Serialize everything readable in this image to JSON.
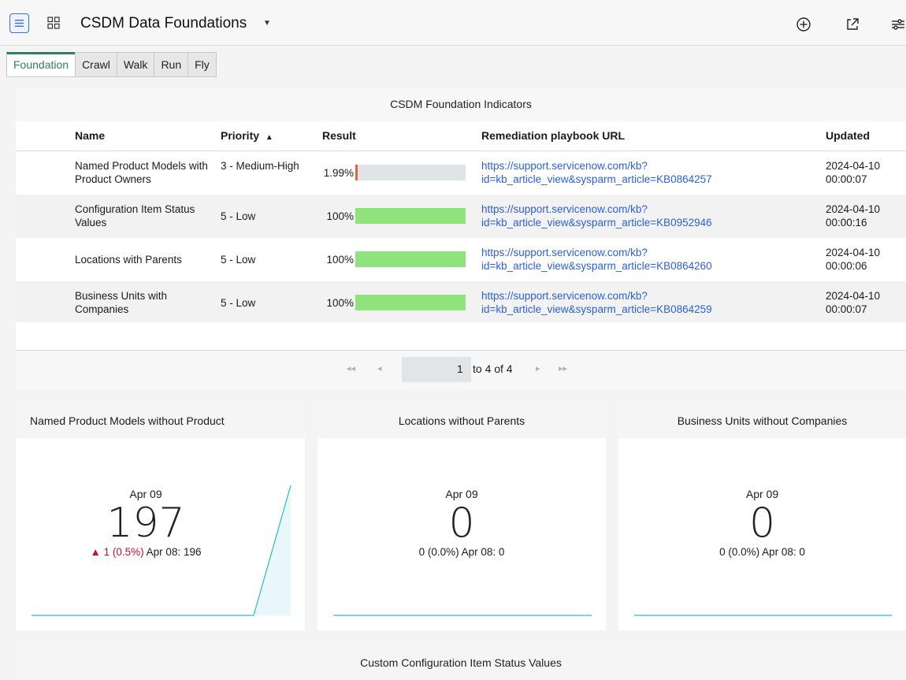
{
  "app": {
    "title": "CSDM Data Foundations"
  },
  "header_icons": [
    "menu-icon",
    "grid-icon",
    "add-icon",
    "share-icon",
    "filter-settings-icon"
  ],
  "tabs": [
    {
      "label": "Foundation",
      "active": true
    },
    {
      "label": "Crawl",
      "active": false
    },
    {
      "label": "Walk",
      "active": false
    },
    {
      "label": "Run",
      "active": false
    },
    {
      "label": "Fly",
      "active": false
    }
  ],
  "indicators": {
    "title": "CSDM Foundation Indicators",
    "columns": {
      "name": "Name",
      "priority": "Priority",
      "priority_sort": "▲",
      "result": "Result",
      "url": "Remediation playbook URL",
      "updated": "Updated"
    },
    "rows": [
      {
        "name": "Named Product Models with Product Owners",
        "priority": "3 - Medium-High",
        "result": "1.99%",
        "result_value": 1.99,
        "result_color": "#e8624a",
        "url": "https://support.servicenow.com/kb?id=kb_article_view&sysparm_article=KB0864257",
        "url_line1": "https://support.servicenow.com/kb?",
        "url_line2": "id=kb_article_view&sysparm_article=KB0864257",
        "updated_date": "2024-04-10",
        "updated_time": "00:00:07"
      },
      {
        "name": "Configuration Item Status Values",
        "priority": "5 - Low",
        "result": "100%",
        "result_value": 100,
        "result_color": "#8ee37d",
        "url_line1": "https://support.servicenow.com/kb?",
        "url_line2": "id=kb_article_view&sysparm_article=KB0952946",
        "updated_date": "2024-04-10",
        "updated_time": "00:00:16"
      },
      {
        "name": "Locations with Parents",
        "priority": "5 - Low",
        "result": "100%",
        "result_value": 100,
        "result_color": "#8ee37d",
        "url_line1": "https://support.servicenow.com/kb?",
        "url_line2": "id=kb_article_view&sysparm_article=KB0864260",
        "updated_date": "2024-04-10",
        "updated_time": "00:00:06"
      },
      {
        "name": "Business Units with Companies",
        "priority": "5 - Low",
        "result": "100%",
        "result_value": 100,
        "result_color": "#8ee37d",
        "url_line1": "https://support.servicenow.com/kb?",
        "url_line2": "id=kb_article_view&sysparm_article=KB0864259",
        "updated_date": "2024-04-10",
        "updated_time": "00:00:07"
      }
    ],
    "pagination": {
      "current": "1",
      "range_text": "to 4 of 4",
      "first": "◂◂",
      "prev": "◂",
      "next": "▸",
      "last": "▸▸"
    }
  },
  "cards": [
    {
      "title": "Named Product Models without Product",
      "date": "Apr 09",
      "value": "197",
      "delta": "▲ 1 (0.5%)",
      "prev": "Apr 08: 196",
      "trend": [
        0,
        0,
        0,
        0,
        0,
        0,
        0,
        1
      ]
    },
    {
      "title": "Locations without Parents",
      "date": "Apr 09",
      "value": "0",
      "delta": "0 (0.0%)",
      "prev": "Apr 08: 0",
      "trend": [
        0,
        0,
        0,
        0,
        0,
        0,
        0,
        0
      ]
    },
    {
      "title": "Business Units without Companies",
      "date": "Apr 09",
      "value": "0",
      "delta": "0 (0.0%)",
      "prev": "Apr 08: 0",
      "trend": [
        0,
        0,
        0,
        0,
        0,
        0,
        0,
        0
      ]
    }
  ],
  "bottom_panel": {
    "title": "Custom Configuration Item Status Values"
  },
  "colors": {
    "accent": "#2f7d63",
    "link": "#2a5fe0",
    "spark_line": "#2bb9d6",
    "spark_fill": "#e9f6fb",
    "delta_up": "#c8102e"
  }
}
